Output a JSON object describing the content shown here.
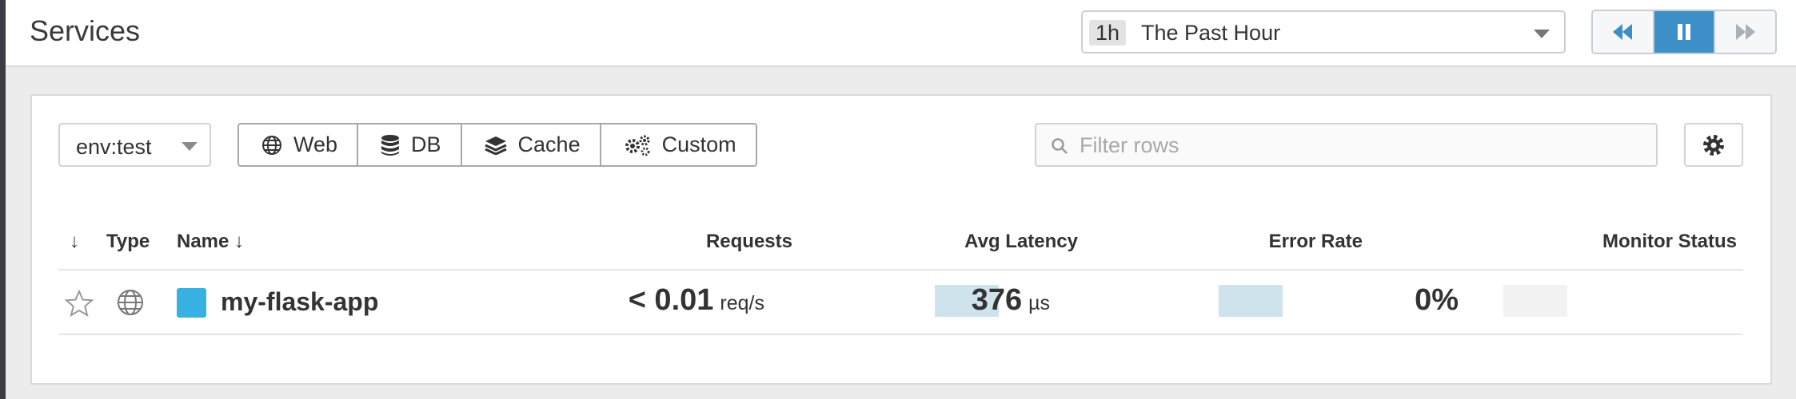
{
  "header": {
    "title": "Services",
    "time_range": {
      "badge": "1h",
      "label": "The Past Hour"
    },
    "playback": {
      "buttons": [
        "rewind-icon",
        "pause-icon",
        "fast-forward-icon"
      ],
      "active_index": 1
    }
  },
  "toolbar": {
    "env_select": {
      "value": "env:test"
    },
    "type_filters": [
      {
        "label": "Web",
        "icon": "globe-icon"
      },
      {
        "label": "DB",
        "icon": "database-icon"
      },
      {
        "label": "Cache",
        "icon": "layers-icon"
      },
      {
        "label": "Custom",
        "icon": "gears-icon"
      }
    ],
    "filter": {
      "placeholder": "Filter rows",
      "value": ""
    },
    "settings_icon": "gear-icon"
  },
  "table": {
    "columns": {
      "sort": "↓",
      "type": "Type",
      "name": "Name ↓",
      "requests": "Requests",
      "latency": "Avg Latency",
      "error_rate": "Error Rate",
      "monitor": "Monitor Status"
    },
    "rows": [
      {
        "favorite": false,
        "type_icon": "globe-icon",
        "name": "my-flask-app",
        "requests": {
          "value": "< 0.01",
          "unit": "req/s"
        },
        "latency": {
          "value": "376",
          "unit": "µs"
        },
        "error_rate": {
          "value": "0%"
        },
        "monitor_status": ""
      }
    ]
  },
  "colors": {
    "accent": "#3d8fc7",
    "service_square": "#37b1e2",
    "sparkline_fill": "#cfe3ec",
    "sparkline_empty": "#f2f2f2"
  }
}
